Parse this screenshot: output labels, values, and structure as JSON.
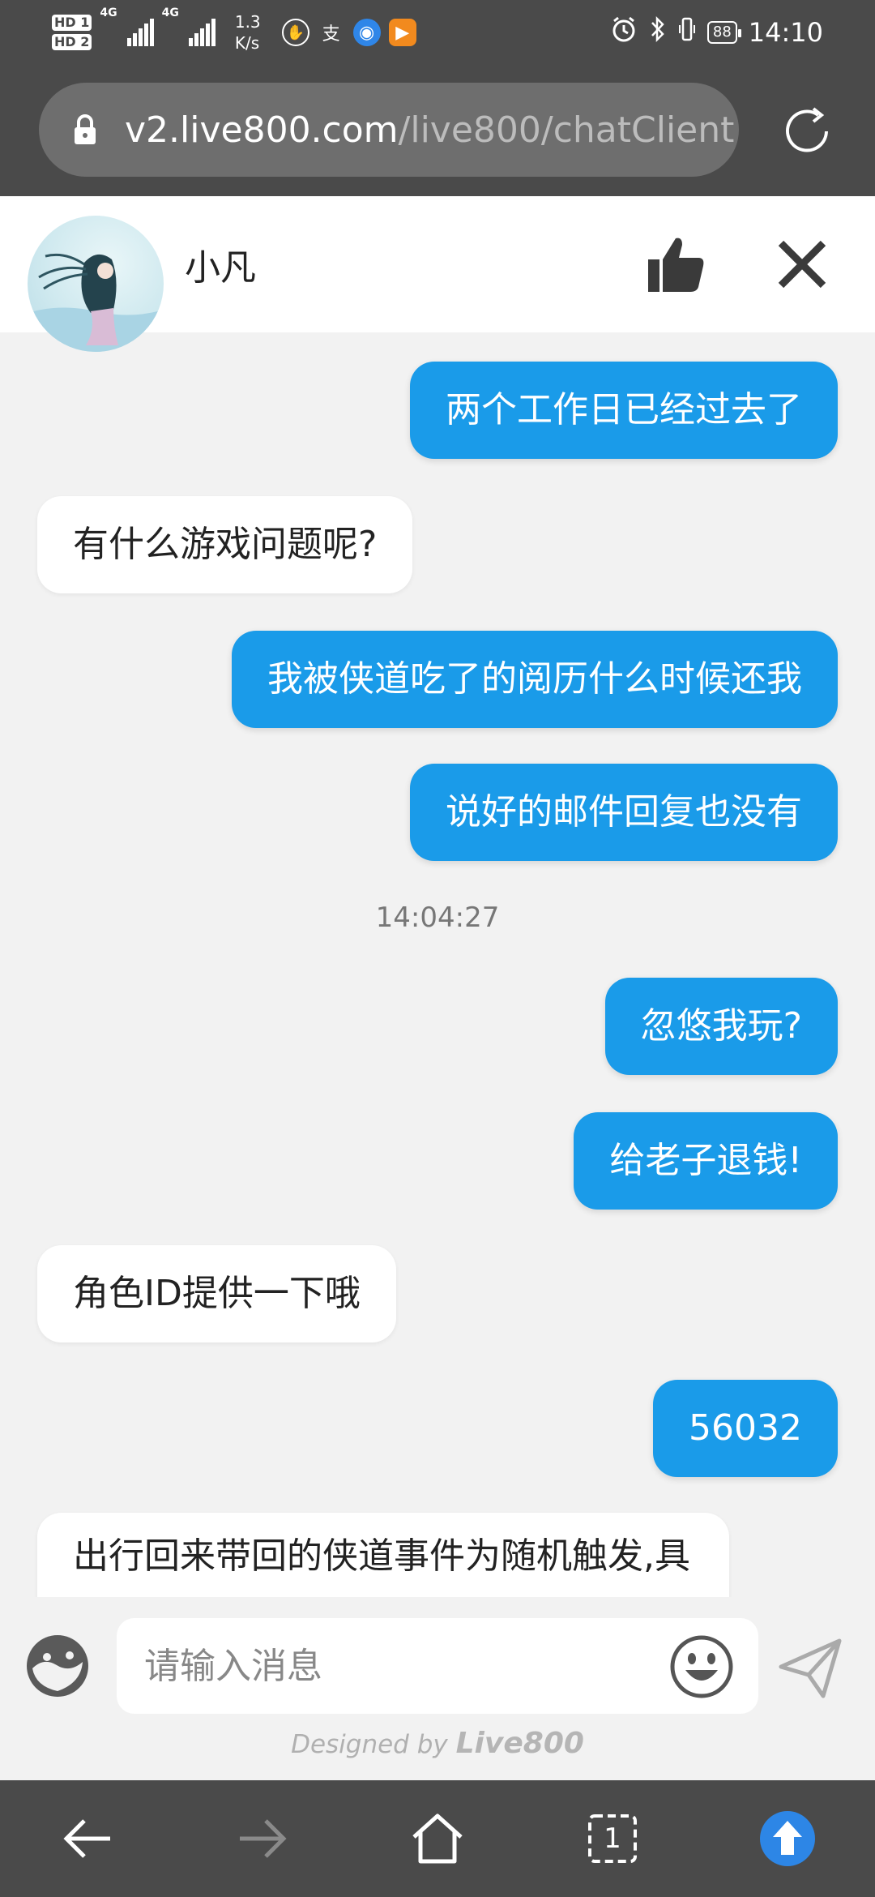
{
  "status_bar": {
    "hd_labels": [
      "HD 1",
      "HD 2"
    ],
    "network": "4G",
    "speed_value": "1.3",
    "speed_unit": "K/s",
    "app_icon_1": "支",
    "battery": "88",
    "time": "14:10"
  },
  "browser": {
    "url_host": "v2.live800.com",
    "url_path": "/live800/chatClient"
  },
  "chat_header": {
    "agent_name": "小凡"
  },
  "messages": [
    {
      "side": "out",
      "text": "两个工作日已经过去了"
    },
    {
      "side": "in",
      "text": "有什么游戏问题呢?"
    },
    {
      "side": "out",
      "text": "我被侠道吃了的阅历什么时候还我"
    },
    {
      "side": "out",
      "text": "说好的邮件回复也没有"
    },
    {
      "side": "time",
      "text": "14:04:27"
    },
    {
      "side": "out",
      "text": "忽悠我玩?"
    },
    {
      "side": "out",
      "text": "给老子退钱!"
    },
    {
      "side": "in",
      "text": "角色ID提供一下哦"
    },
    {
      "side": "out",
      "text": "56032"
    },
    {
      "side": "in",
      "text": "出行回来带回的侠道事件为随机触发,具体请等待一个工作日内答复"
    }
  ],
  "input": {
    "placeholder": "请输入消息"
  },
  "footer": {
    "designed_by": "Designed by",
    "brand": "Live800"
  },
  "bottom_nav": {
    "tab_count": "1"
  },
  "colors": {
    "accent": "#1a9be9",
    "chrome": "#4a4a4a",
    "chat_bg": "#f2f2f2"
  }
}
